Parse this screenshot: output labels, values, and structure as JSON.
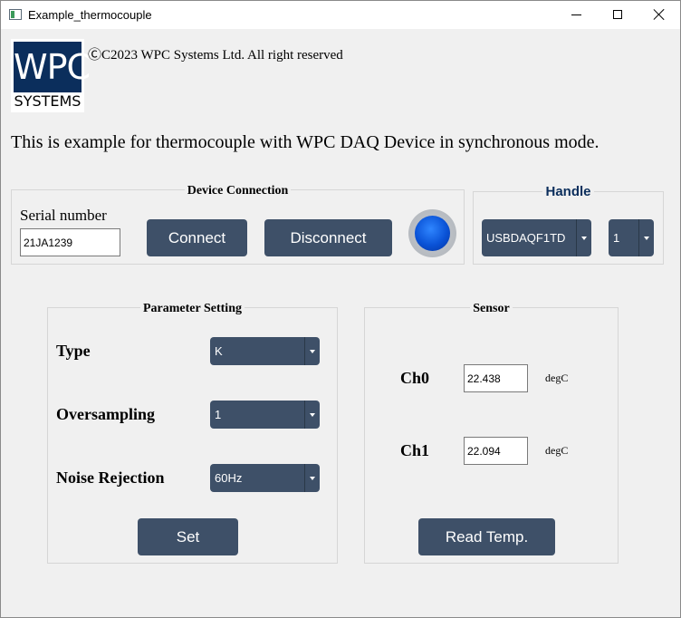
{
  "window": {
    "title": "Example_thermocouple"
  },
  "logo": {
    "line1": "WPC",
    "line2": "SYSTEMS"
  },
  "copyright": "ⒸC2023 WPC Systems Ltd. All right reserved",
  "description": "This is example for thermocouple with WPC DAQ Device in synchronous mode.",
  "device_connection": {
    "title": "Device Connection",
    "serial_label": "Serial number",
    "serial_value": "21JA1239",
    "connect_label": "Connect",
    "disconnect_label": "Disconnect",
    "status_color": "#0a52d6"
  },
  "handle": {
    "title": "Handle",
    "title_color": "#0b2e5c",
    "device_value": "USBDAQF1TD",
    "port_value": "1"
  },
  "parameter_setting": {
    "title": "Parameter Setting",
    "type_label": "Type",
    "type_value": "K",
    "oversampling_label": "Oversampling",
    "oversampling_value": "1",
    "noise_label": "Noise Rejection",
    "noise_value": "60Hz",
    "set_label": "Set"
  },
  "sensor": {
    "title": "Sensor",
    "channels": [
      {
        "label": "Ch0",
        "value": "22.438",
        "unit": "degC"
      },
      {
        "label": "Ch1",
        "value": "22.094",
        "unit": "degC"
      }
    ],
    "read_label": "Read Temp."
  },
  "colors": {
    "button_bg": "#3e5068",
    "window_bg": "#f0f0f0"
  }
}
